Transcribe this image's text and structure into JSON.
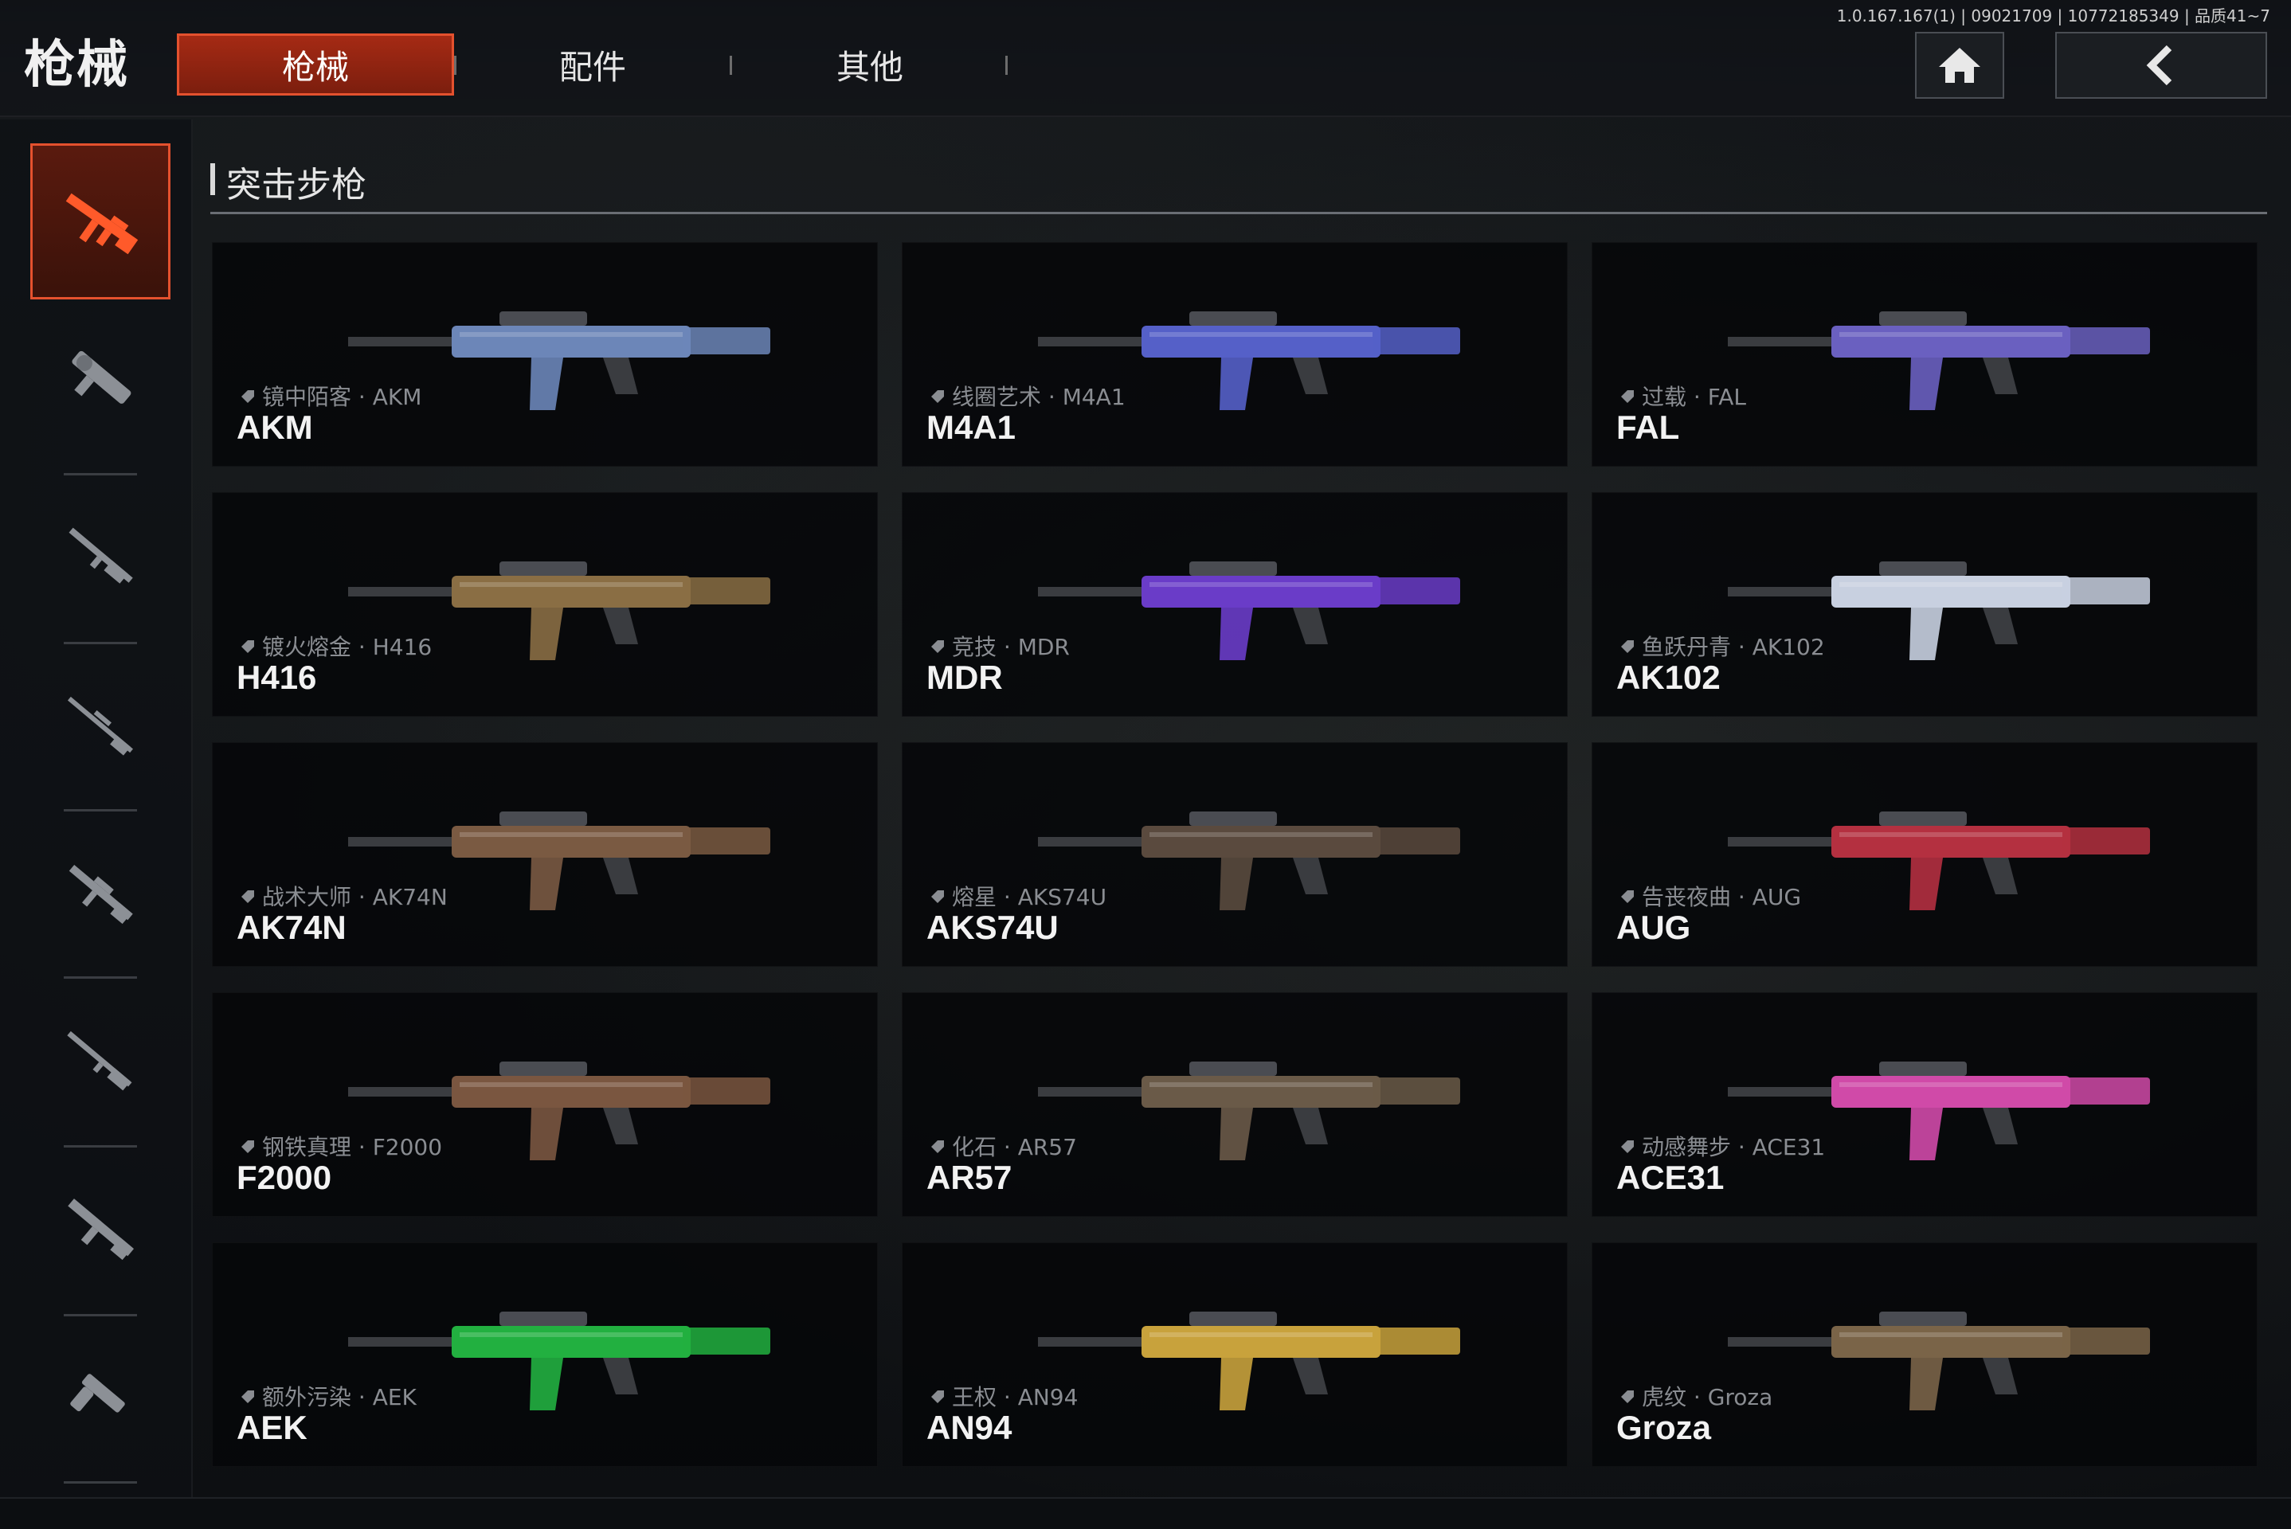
{
  "header": {
    "title": "枪械",
    "tabs": [
      {
        "label": "枪械",
        "active": true
      },
      {
        "label": "配件",
        "active": false
      },
      {
        "label": "其他",
        "active": false
      }
    ],
    "version": "1.0.167.167(1) | 09021709 | 10772185349 | 品质41~7",
    "home_icon": "home-icon",
    "back_icon": "chevron-left-icon"
  },
  "rail": {
    "items": [
      {
        "icon": "assault-rifle-icon",
        "active": true
      },
      {
        "icon": "smg-icon",
        "active": false
      },
      {
        "icon": "shotgun-icon",
        "active": false
      },
      {
        "icon": "sniper-rifle-icon",
        "active": false
      },
      {
        "icon": "marksman-rifle-icon",
        "active": false
      },
      {
        "icon": "long-rifle-icon",
        "active": false
      },
      {
        "icon": "light-machine-gun-icon",
        "active": false
      },
      {
        "icon": "pistol-icon",
        "active": false
      }
    ]
  },
  "section": {
    "title": "突击步枪"
  },
  "colors": {
    "accent": "#e4512e",
    "accent_fill": "#8c2410"
  },
  "weapons": [
    {
      "skin": "镜中陌客 · AKM",
      "name": "AKM",
      "color": "#6c86b8"
    },
    {
      "skin": "线圈艺术 · M4A1",
      "name": "M4A1",
      "color": "#5560c8"
    },
    {
      "skin": "过载 · FAL",
      "name": "FAL",
      "color": "#6a60c0"
    },
    {
      "skin": "镀火熔金 · H416",
      "name": "H416",
      "color": "#8a6e44"
    },
    {
      "skin": "竞技 · MDR",
      "name": "MDR",
      "color": "#6a3cc8"
    },
    {
      "skin": "鱼跃丹青 · AK102",
      "name": "AK102",
      "color": "#c8d0e0"
    },
    {
      "skin": "战术大师 · AK74N",
      "name": "AK74N",
      "color": "#7a5a42"
    },
    {
      "skin": "熔星 · AKS74U",
      "name": "AKS74U",
      "color": "#5a4a3e"
    },
    {
      "skin": "告丧夜曲 · AUG",
      "name": "AUG",
      "color": "#b43040"
    },
    {
      "skin": "钢铁真理 · F2000",
      "name": "F2000",
      "color": "#7a5640"
    },
    {
      "skin": "化石 · AR57",
      "name": "AR57",
      "color": "#6a5a48"
    },
    {
      "skin": "动感舞步 · ACE31",
      "name": "ACE31",
      "color": "#d04aa8"
    },
    {
      "skin": "额外污染 · AEK",
      "name": "AEK",
      "color": "#22b040"
    },
    {
      "skin": "王权 · AN94",
      "name": "AN94",
      "color": "#c8a23c"
    },
    {
      "skin": "虎纹 · Groza",
      "name": "Groza",
      "color": "#7a6448"
    }
  ]
}
